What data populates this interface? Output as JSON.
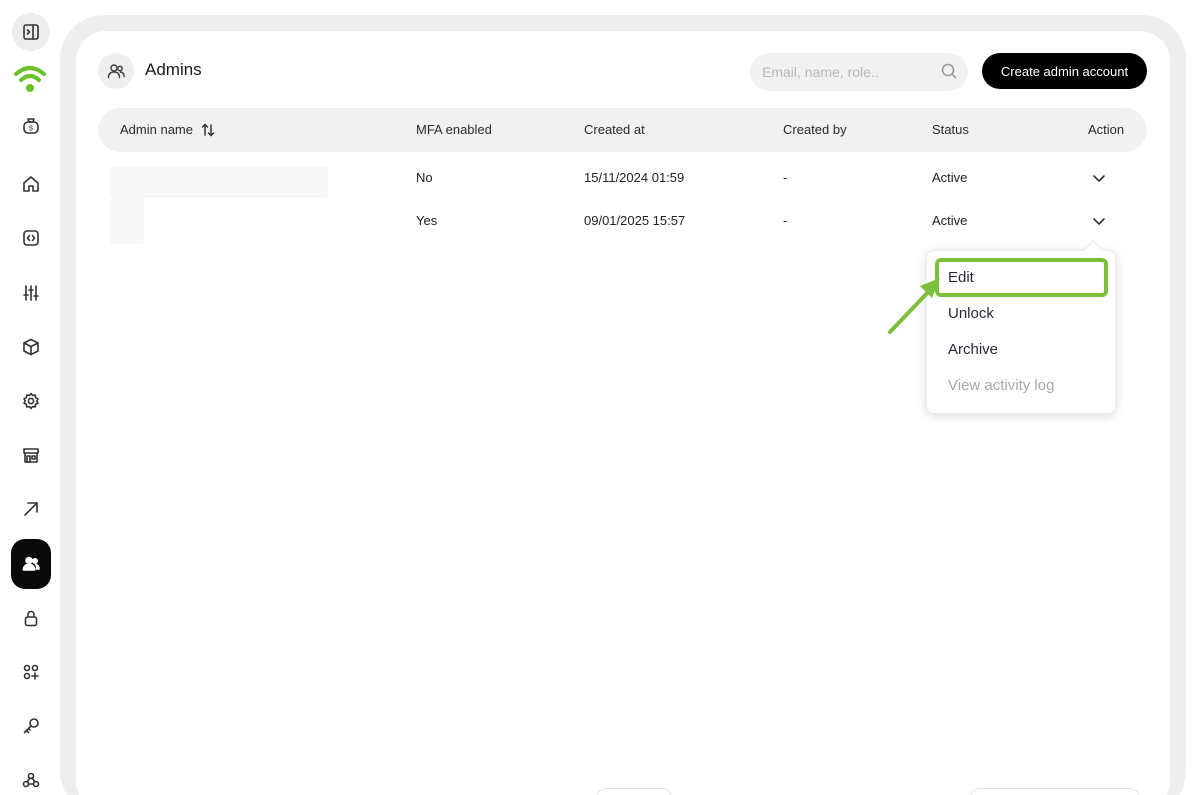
{
  "page": {
    "title": "Admins"
  },
  "search": {
    "placeholder": "Email, name, role.."
  },
  "toolbar": {
    "create_label": "Create admin account"
  },
  "table": {
    "columns": [
      "Admin name",
      "MFA enabled",
      "Created at",
      "Created by",
      "Status",
      "Action"
    ],
    "rows": [
      {
        "admin_name": "",
        "mfa_enabled": "No",
        "created_at": "15/11/2024 01:59",
        "created_by": "-",
        "status": "Active"
      },
      {
        "admin_name": "",
        "mfa_enabled": "Yes",
        "created_at": "09/01/2025 15:57",
        "created_by": "-",
        "status": "Active"
      }
    ]
  },
  "action_menu": {
    "items": [
      {
        "label": "Edit",
        "enabled": true,
        "highlighted": true
      },
      {
        "label": "Unlock",
        "enabled": true
      },
      {
        "label": "Archive",
        "enabled": true
      },
      {
        "label": "View activity log",
        "enabled": false
      }
    ]
  },
  "sidebar": {
    "items": [
      {
        "icon": "sidebar-toggle-icon"
      },
      {
        "icon": "wifi-logo-icon"
      },
      {
        "icon": "money-bag-icon"
      },
      {
        "icon": "home-icon"
      },
      {
        "icon": "code-icon"
      },
      {
        "icon": "sliders-icon"
      },
      {
        "icon": "cube-icon"
      },
      {
        "icon": "gear-icon"
      },
      {
        "icon": "store-icon"
      },
      {
        "icon": "arrow-up-right-icon"
      },
      {
        "icon": "users-icon",
        "active": true
      },
      {
        "icon": "lock-icon"
      },
      {
        "icon": "apps-plus-icon"
      },
      {
        "icon": "key-icon"
      },
      {
        "icon": "webhook-icon"
      }
    ]
  },
  "colors": {
    "accent": "#7bbf3a",
    "primary_button": "#000000",
    "header_bg": "#f1f1f2"
  }
}
